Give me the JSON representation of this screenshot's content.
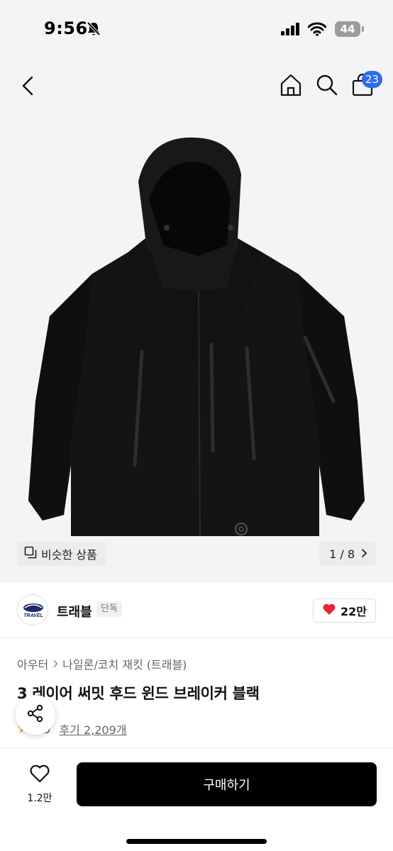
{
  "status_bar": {
    "time": "9:56",
    "battery": "44",
    "icons": [
      "bell-slash-icon",
      "signal-icon",
      "wifi-icon",
      "battery-icon"
    ]
  },
  "nav": {
    "icons": [
      "back-icon",
      "home-icon",
      "search-icon",
      "shopping-bag-icon"
    ],
    "cart_count": "23"
  },
  "gallery": {
    "similar_label": "비슷한 상품",
    "counter": "1 / 8",
    "image_subject": "black hooded jacket"
  },
  "brand": {
    "name": "트래블",
    "tag": "단독",
    "logo_text": "TRAVEL",
    "likes": "22만"
  },
  "product": {
    "breadcrumb": [
      "아우터",
      "나일론/코치 재킷 (트래블)"
    ],
    "title": "3 레이어 써밋 후드 윈드 브레이커 블랙",
    "rating": "4.9",
    "reviews": "후기 2,209개"
  },
  "bottom_bar": {
    "wish_count": "1.2만",
    "buy_label": "구매하기"
  },
  "colors": {
    "accent_badge": "#2d6cf0",
    "heart": "#e8243a",
    "star": "#f5a623",
    "buy_button": "#000000"
  }
}
